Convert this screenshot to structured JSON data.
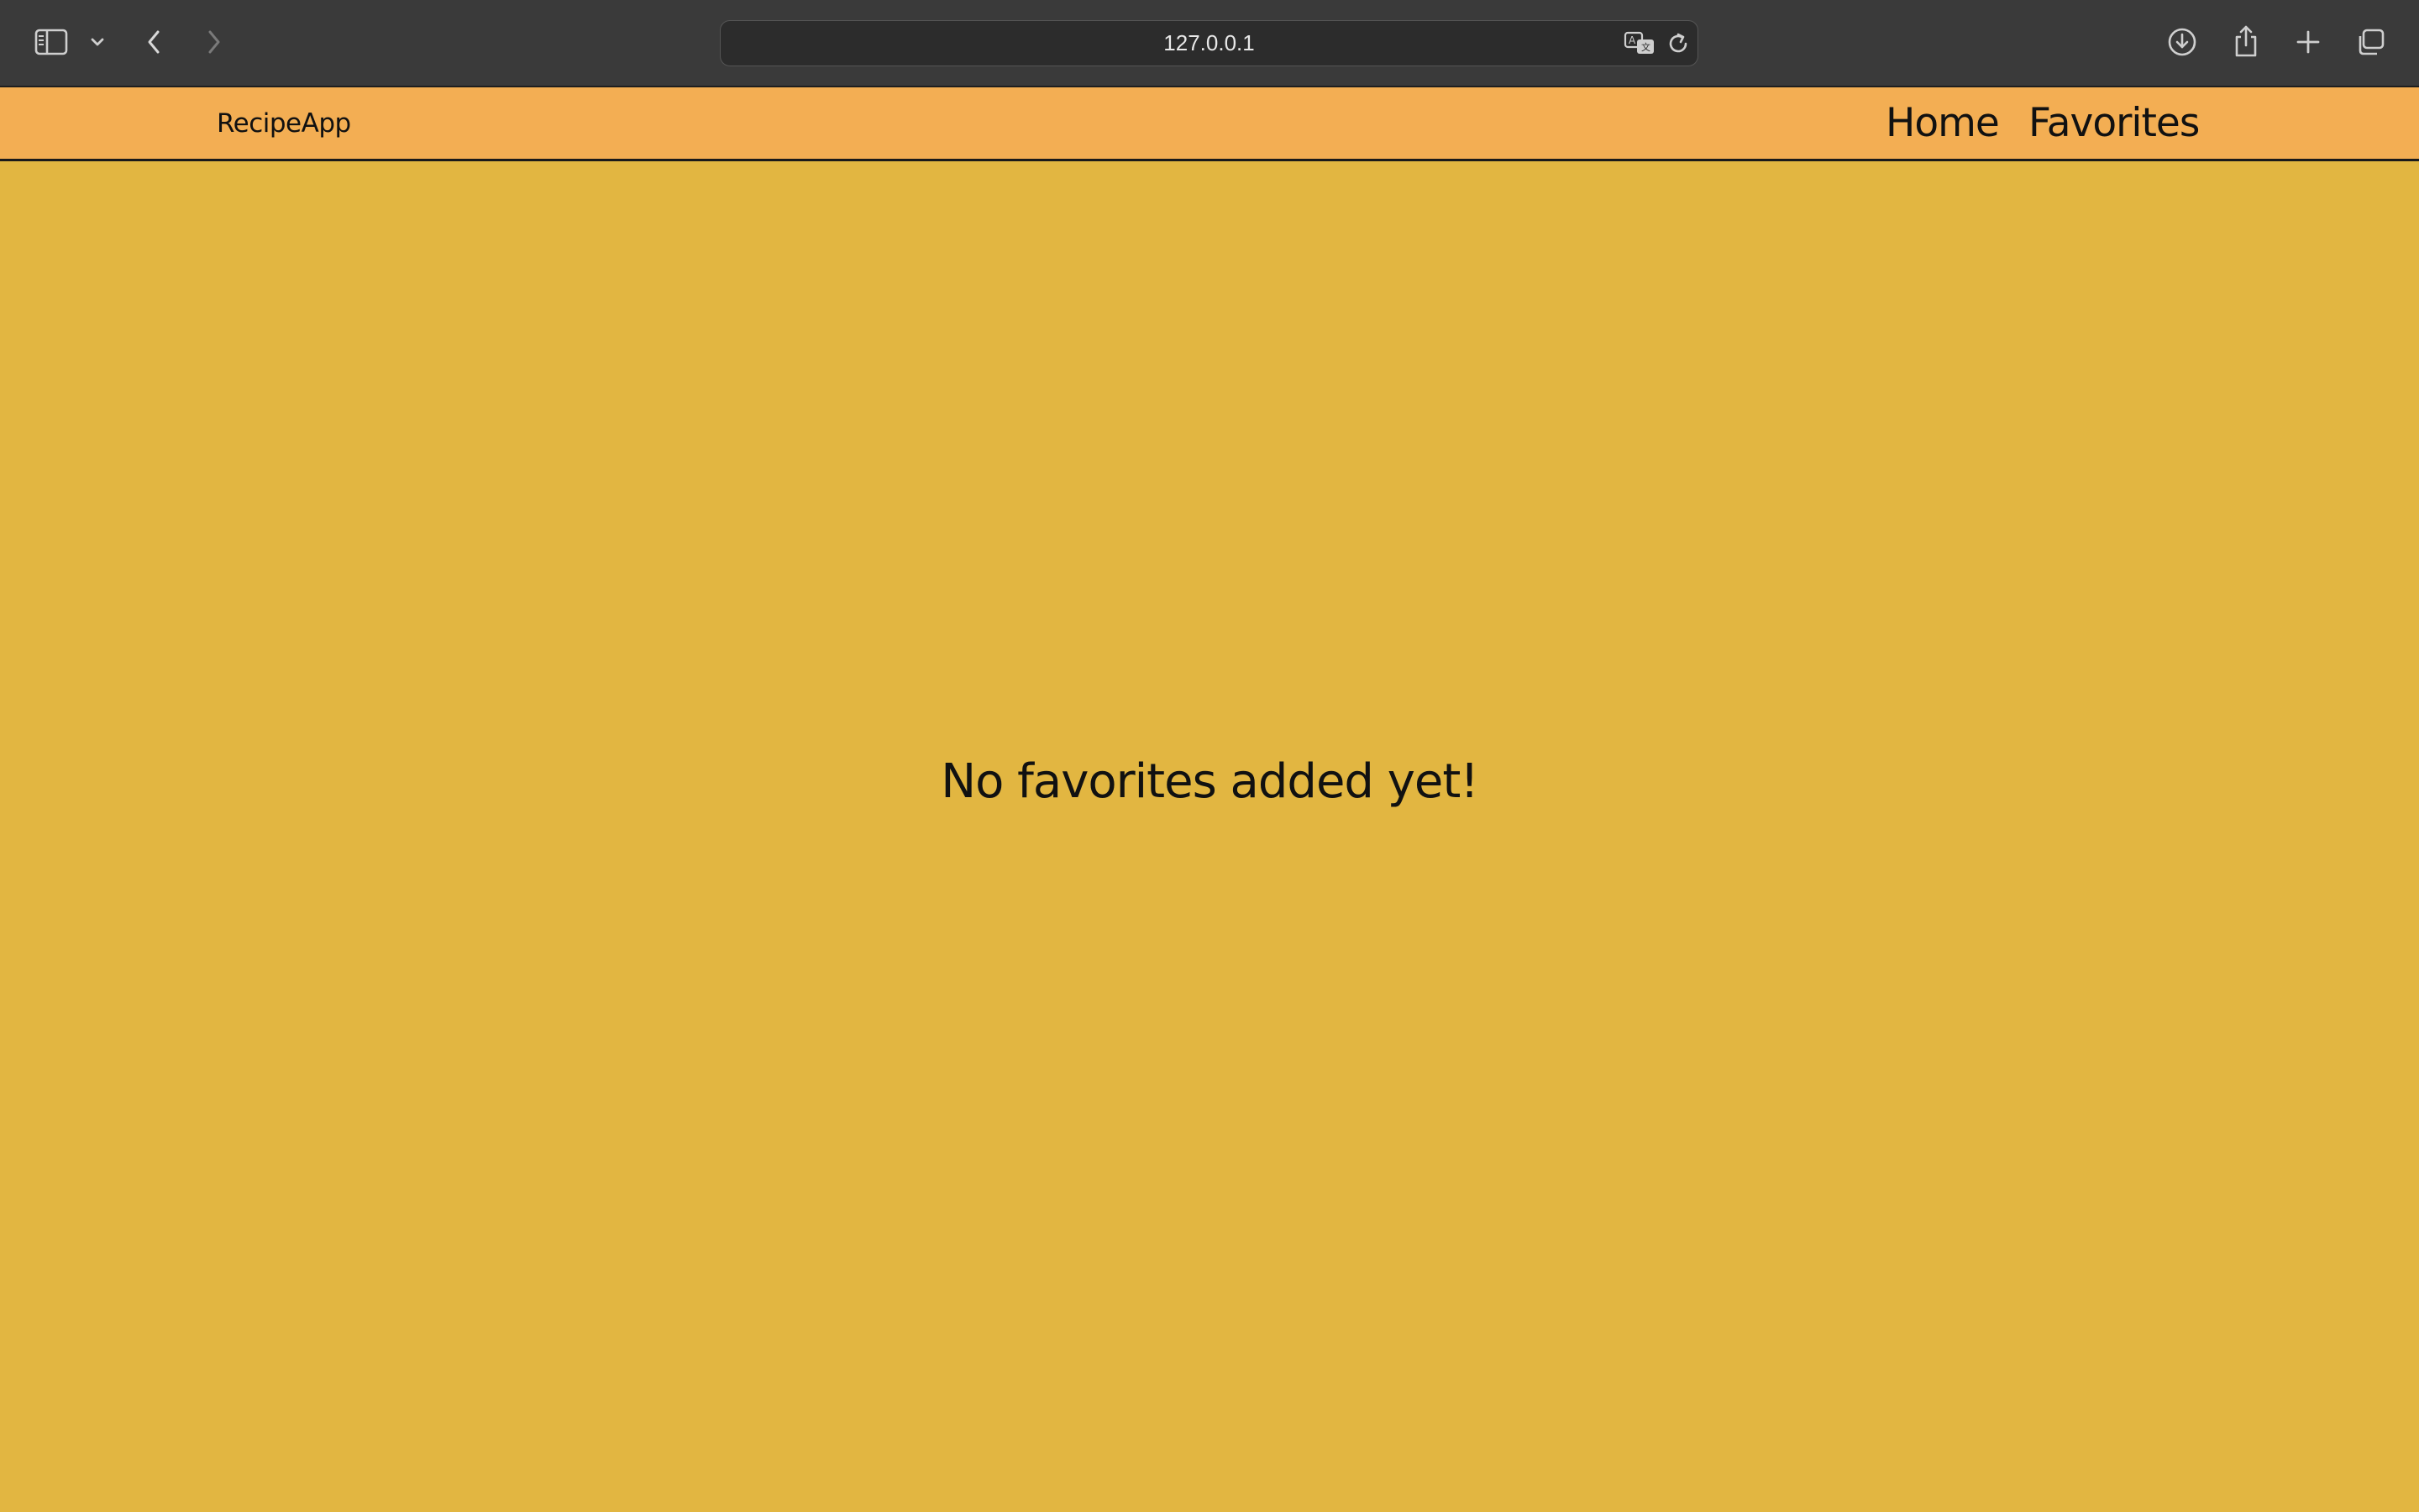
{
  "browser": {
    "url": "127.0.0.1",
    "icons": {
      "sidebar": "sidebar-icon",
      "sidebar_menu": "chevron-down-icon",
      "back": "chevron-left-icon",
      "forward": "chevron-right-icon",
      "translate": "translate-icon",
      "reload": "reload-icon",
      "downloads": "download-icon",
      "share": "share-icon",
      "new_tab": "plus-icon",
      "tabs": "tabs-overview-icon"
    }
  },
  "navbar": {
    "brand": "RecipeApp",
    "links": [
      {
        "label": "Home"
      },
      {
        "label": "Favorites"
      }
    ],
    "background": "#f3ae53"
  },
  "main": {
    "empty_message": "No favorites added yet!",
    "background": "#e2b641"
  }
}
